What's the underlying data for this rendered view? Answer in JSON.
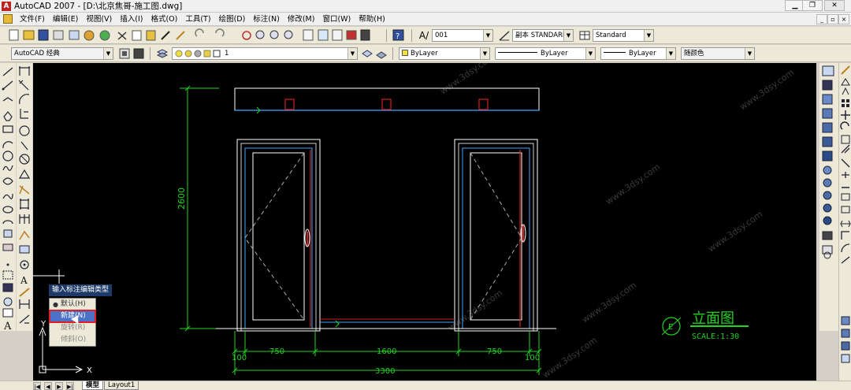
{
  "window": {
    "title": "AutoCAD 2007 - [D:\\北京焦哥-施工图.dwg]",
    "icon": "autocad-logo"
  },
  "menu": {
    "items": [
      "文件(F)",
      "编辑(E)",
      "视图(V)",
      "插入(I)",
      "格式(O)",
      "工具(T)",
      "绘图(D)",
      "标注(N)",
      "修改(M)",
      "窗口(W)",
      "帮助(H)"
    ]
  },
  "toolbar1": {
    "text_style_combo": "001",
    "dim_style_combo": "副本 STANDARI",
    "table_style_combo": "Standard"
  },
  "toolbar2": {
    "workspace_combo": "AutoCAD 经典",
    "layer_combo": "1",
    "color_combo": "ByLayer",
    "linetype_combo": "ByLayer",
    "lineweight_combo": "ByLayer",
    "plotstyle_combo": "随颜色"
  },
  "drawing": {
    "height_dim": "2600",
    "dims": [
      "100",
      "750",
      "1600",
      "750",
      "100"
    ],
    "total_width_dim": "3300",
    "view_title": "立面图",
    "scale": "SCALE:1:30",
    "marker_letter": "E",
    "ucs_x": "X",
    "ucs_y": "Y",
    "watermark": "www.3dsy.com"
  },
  "prompt": {
    "text": "输入标注编辑类型"
  },
  "context_menu": {
    "items": [
      {
        "label": "默认(H)",
        "bullet": "●",
        "state": "normal"
      },
      {
        "label": "新建(N)",
        "bullet": "",
        "state": "selected"
      },
      {
        "label": "旋转(R)",
        "bullet": "",
        "state": "disabled"
      },
      {
        "label": "倾斜(O)",
        "bullet": "",
        "state": "disabled"
      }
    ]
  },
  "tabs": {
    "model": "模型",
    "layout1": "Layout1"
  },
  "colors": {
    "canvas_bg": "#000000",
    "dim_green": "#1fd31f",
    "wall_white": "#ffffff",
    "cyan_line": "#3fa8ff",
    "red_line": "#d02020"
  }
}
